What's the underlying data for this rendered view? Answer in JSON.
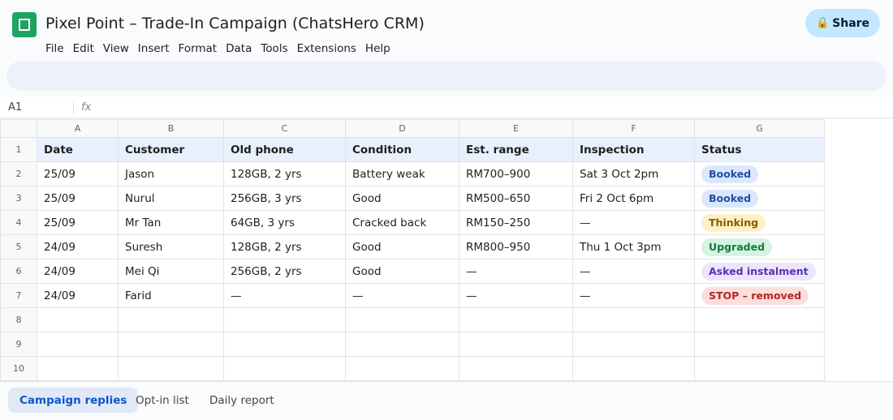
{
  "header": {
    "title": "Pixel Point – Trade-In Campaign (ChatsHero CRM)",
    "menu": [
      "File",
      "Edit",
      "View",
      "Insert",
      "Format",
      "Data",
      "Tools",
      "Extensions",
      "Help"
    ],
    "share_label": "Share",
    "share_icon": "lock-icon"
  },
  "formula_bar": {
    "cell_ref": "A1",
    "fx_label": "fx"
  },
  "grid": {
    "column_letters": [
      "A",
      "B",
      "C",
      "D",
      "E",
      "F",
      "G"
    ],
    "headers": [
      "Date",
      "Customer",
      "Old phone",
      "Condition",
      "Est. range",
      "Inspection",
      "Status"
    ],
    "rows": [
      {
        "n": "2",
        "cells": [
          "25/09",
          "Jason",
          "128GB, 2 yrs",
          "Battery weak",
          "RM700–900",
          "Sat 3 Oct 2pm"
        ],
        "status": "Booked",
        "status_kind": "booked"
      },
      {
        "n": "3",
        "cells": [
          "25/09",
          "Nurul",
          "256GB, 3 yrs",
          "Good",
          "RM500–650",
          "Fri 2 Oct 6pm"
        ],
        "status": "Booked",
        "status_kind": "booked"
      },
      {
        "n": "4",
        "cells": [
          "25/09",
          "Mr Tan",
          "64GB, 3 yrs",
          "Cracked back",
          "RM150–250",
          "—"
        ],
        "status": "Thinking",
        "status_kind": "thinking"
      },
      {
        "n": "5",
        "cells": [
          "24/09",
          "Suresh",
          "128GB, 2 yrs",
          "Good",
          "RM800–950",
          "Thu 1 Oct 3pm"
        ],
        "status": "Upgraded",
        "status_kind": "upgraded"
      },
      {
        "n": "6",
        "cells": [
          "24/09",
          "Mei Qi",
          "256GB, 2 yrs",
          "Good",
          "—",
          "—"
        ],
        "status": "Asked instalment",
        "status_kind": "instalment"
      },
      {
        "n": "7",
        "cells": [
          "24/09",
          "Farid",
          "—",
          "—",
          "—",
          "—"
        ],
        "status": "STOP – removed",
        "status_kind": "stop"
      }
    ],
    "empty_rows": [
      "8",
      "9",
      "10"
    ],
    "status_colors": {
      "booked": {
        "bg": "#dbe7fb",
        "fg": "#1f4fa8"
      },
      "thinking": {
        "bg": "#fdf0c2",
        "fg": "#8a5a00"
      },
      "upgraded": {
        "bg": "#d4f3e2",
        "fg": "#137a3d"
      },
      "instalment": {
        "bg": "#ece6fb",
        "fg": "#5b2fb5"
      },
      "stop": {
        "bg": "#fcdede",
        "fg": "#b3261e"
      }
    }
  },
  "sheet_tabs": [
    {
      "label": "Campaign replies",
      "active": true
    },
    {
      "label": "Opt-in list",
      "active": false
    },
    {
      "label": "Daily report",
      "active": false
    }
  ]
}
